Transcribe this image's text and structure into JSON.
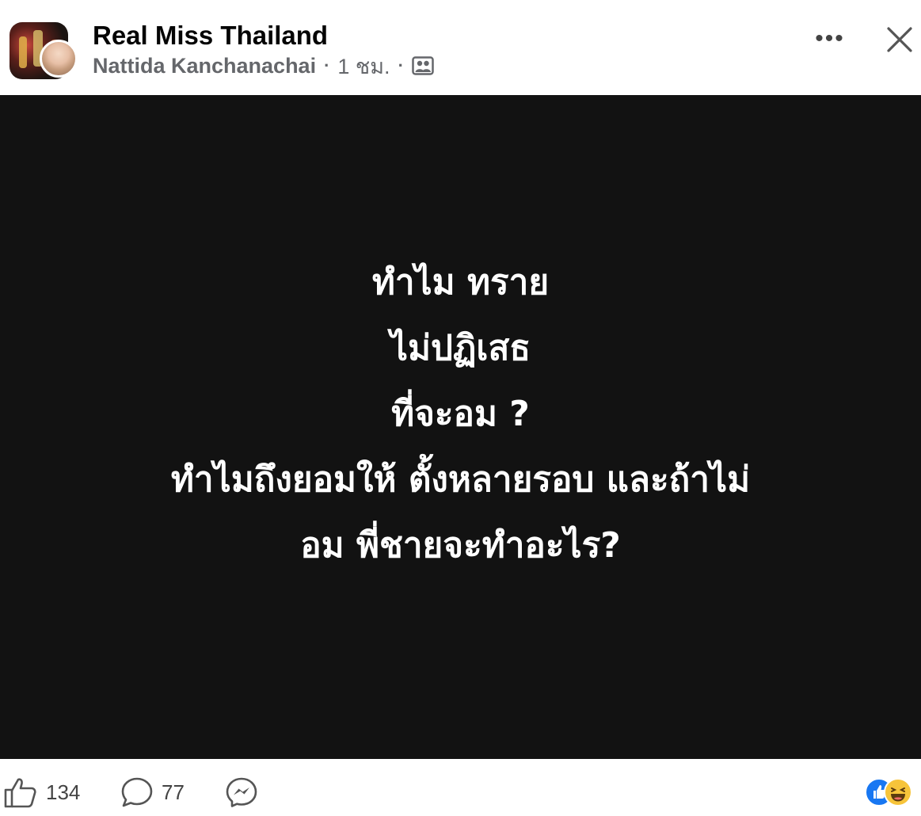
{
  "header": {
    "page_name": "Real Miss Thailand",
    "author": "Nattida Kanchanachai",
    "separator": "·",
    "time": "1 ชม.",
    "audience_icon": "group-icon",
    "more_icon": "more-horizontal-icon",
    "more_label": "•••",
    "close_icon": "close-icon"
  },
  "post": {
    "background_color": "#121212",
    "text_color": "#ffffff",
    "lines": [
      "ทำไม ทราย",
      "ไม่ปฏิเสธ",
      "ที่จะอม ?",
      "ทำไมถึงยอมให้ ตั้งหลายรอบ และถ้าไม่",
      "อม พี่ชายจะทำอะไร?"
    ]
  },
  "footer": {
    "like_icon": "thumbs-up-icon",
    "like_count": "134",
    "comment_icon": "comment-icon",
    "comment_count": "77",
    "share_icon": "messenger-icon",
    "reactions": [
      "like-reaction-icon",
      "haha-reaction-icon"
    ]
  }
}
